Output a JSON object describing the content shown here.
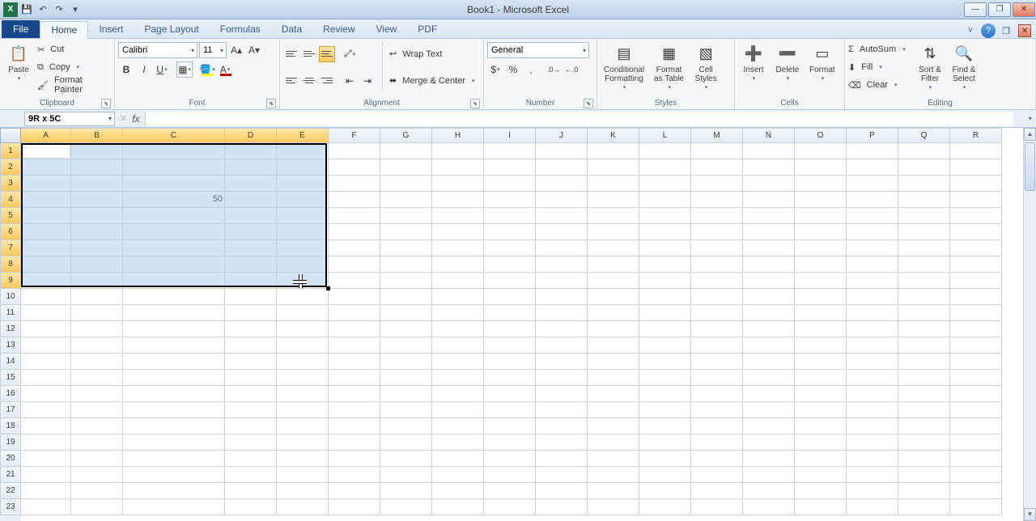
{
  "app": {
    "title": "Book1 - Microsoft Excel",
    "product_initial": "X"
  },
  "tabs": {
    "file": "File",
    "list": [
      "Home",
      "Insert",
      "Page Layout",
      "Formulas",
      "Data",
      "Review",
      "View",
      "PDF"
    ],
    "active_index": 0
  },
  "ribbon": {
    "clipboard": {
      "label": "Clipboard",
      "paste": "Paste",
      "cut": "Cut",
      "copy": "Copy",
      "format_painter": "Format Painter"
    },
    "font": {
      "label": "Font",
      "family": "Calibri",
      "size": "11"
    },
    "alignment": {
      "label": "Alignment",
      "wrap": "Wrap Text",
      "merge": "Merge & Center"
    },
    "number": {
      "label": "Number",
      "format": "General"
    },
    "styles": {
      "label": "Styles",
      "conditional": "Conditional\nFormatting",
      "table": "Format\nas Table",
      "cell": "Cell\nStyles"
    },
    "cells": {
      "label": "Cells",
      "insert": "Insert",
      "delete": "Delete",
      "format": "Format"
    },
    "editing": {
      "label": "Editing",
      "autosum": "AutoSum",
      "fill": "Fill",
      "clear": "Clear",
      "sort": "Sort &\nFilter",
      "find": "Find &\nSelect"
    }
  },
  "namebox": "9R x 5C",
  "grid": {
    "columns": [
      "A",
      "B",
      "C",
      "D",
      "E",
      "F",
      "G",
      "H",
      "I",
      "J",
      "K",
      "L",
      "M",
      "N",
      "O",
      "P",
      "Q",
      "R"
    ],
    "rows": 23,
    "selected_cols": 5,
    "selected_rows": 9,
    "cell_C4": "50"
  }
}
